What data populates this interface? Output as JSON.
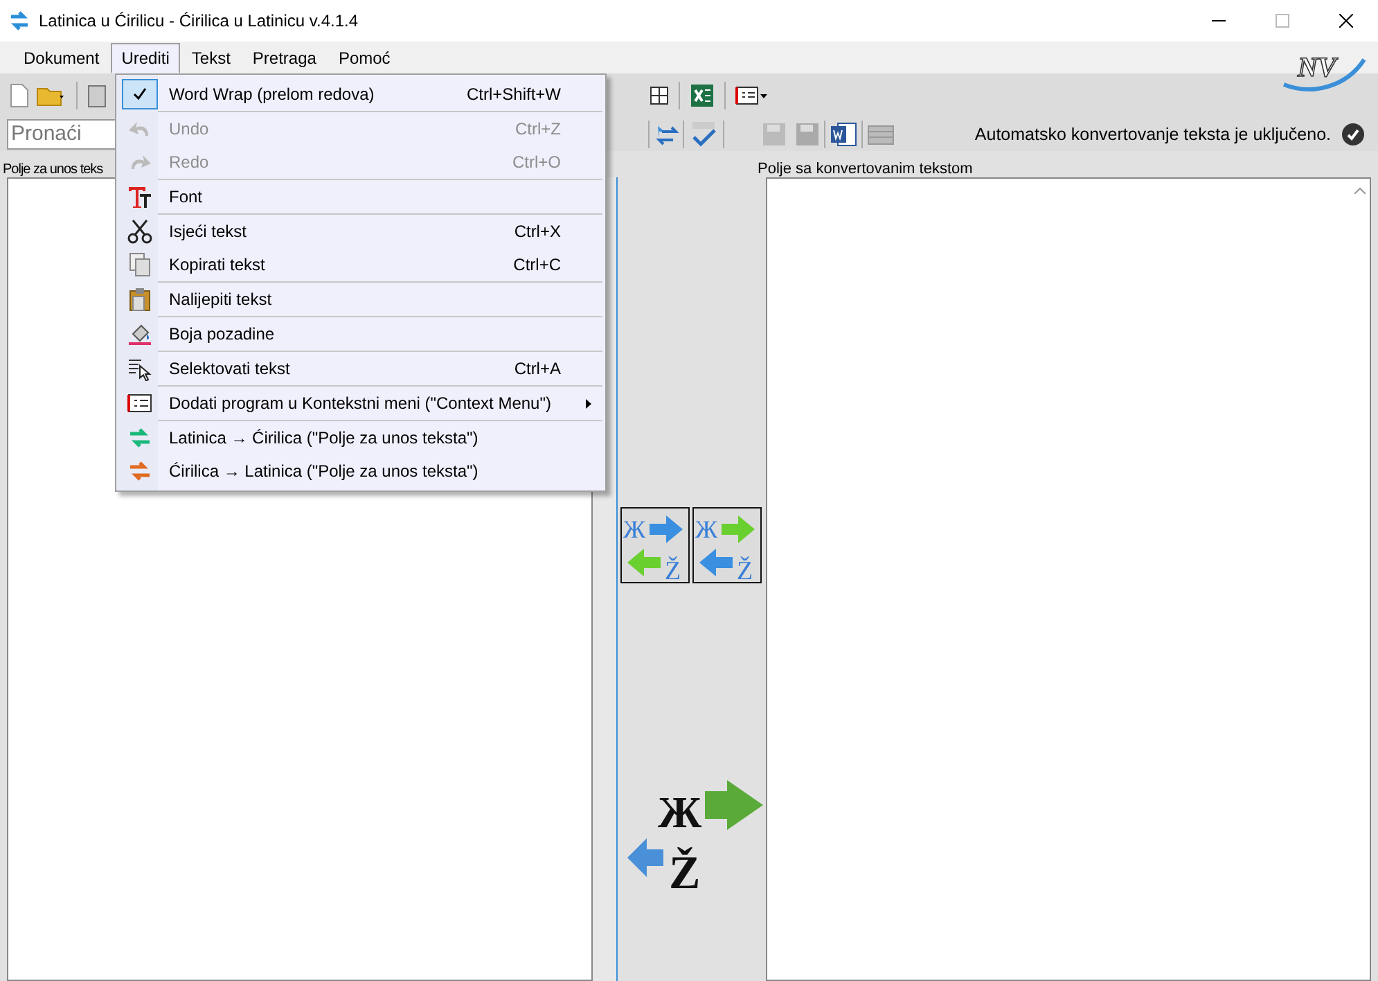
{
  "window": {
    "title": "Latinica u Ćirilicu - Ćirilica u Latinicu v.4.1.4"
  },
  "menu_bar": [
    {
      "label": "Dokument",
      "selected": false
    },
    {
      "label": "Urediti",
      "selected": true
    },
    {
      "label": "Tekst",
      "selected": false
    },
    {
      "label": "Pretraga",
      "selected": false
    },
    {
      "label": "Pomoć",
      "selected": false
    }
  ],
  "logo": {
    "text": "NV"
  },
  "search": {
    "placeholder": "Pronaći"
  },
  "status": {
    "text": "Automatsko konvertovanje teksta je uključeno.",
    "on": true
  },
  "input_panel": {
    "label": "Polje za unos teks"
  },
  "output_panel": {
    "label": "Polje sa konvertovanim tekstom"
  },
  "convert_buttons": [
    {
      "glyphs": [
        "Ж",
        "Ž"
      ]
    },
    {
      "glyphs": [
        "Ж",
        "Ž"
      ]
    }
  ],
  "convert_logo": {
    "glyphs": [
      "Ж",
      "Ž"
    ]
  },
  "dropdown": {
    "groups": [
      [
        {
          "kind": "check",
          "label": "Word Wrap (prelom redova)",
          "shortcut": "Ctrl+Shift+W",
          "checked": true,
          "disabled": false
        }
      ],
      [
        {
          "kind": "command",
          "label": "Undo",
          "shortcut": "Ctrl+Z",
          "disabled": true
        },
        {
          "kind": "command",
          "label": "Redo",
          "shortcut": "Ctrl+O",
          "disabled": true
        }
      ],
      [
        {
          "kind": "command",
          "label": "Font",
          "disabled": false
        }
      ],
      [
        {
          "kind": "command",
          "label": "Isjeći tekst",
          "shortcut": "Ctrl+X",
          "disabled": false
        },
        {
          "kind": "command",
          "label": "Kopirati tekst",
          "shortcut": "Ctrl+C",
          "disabled": false
        }
      ],
      [
        {
          "kind": "command",
          "label": "Nalijepiti tekst",
          "disabled": false
        }
      ],
      [
        {
          "kind": "command",
          "label": "Boja pozadine",
          "disabled": false
        }
      ],
      [
        {
          "kind": "command",
          "label": "Selektovati tekst",
          "shortcut": "Ctrl+A",
          "disabled": false
        }
      ],
      [
        {
          "kind": "submenu",
          "label": "Dodati program u Kontekstni meni (\"Context Menu\")",
          "disabled": false
        }
      ],
      [
        {
          "kind": "command",
          "label": "Latinica → Ćirilica (\"Polje za unos teksta\")",
          "disabled": false
        },
        {
          "kind": "command",
          "label": "Ćirilica → Latinica (\"Polje za unos teksta\")",
          "disabled": false
        }
      ]
    ]
  }
}
